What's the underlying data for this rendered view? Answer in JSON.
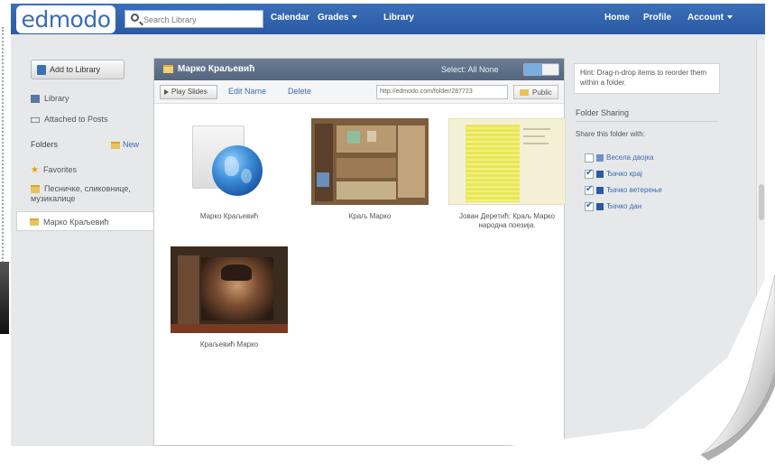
{
  "brand": {
    "logo_text": "edmodo"
  },
  "search": {
    "placeholder": "Search Library"
  },
  "nav": {
    "calendar": "Calendar",
    "grades": "Grades",
    "library": "Library",
    "home": "Home",
    "profile": "Profile",
    "account": "Account"
  },
  "sidebar": {
    "add_button": "Add to Library",
    "library": "Library",
    "attached": "Attached to Posts",
    "folders_label": "Folders",
    "new_label": "New",
    "items": [
      {
        "label": "Favorites"
      },
      {
        "label": "Песничке, сликовнице, музикалице"
      },
      {
        "label": "Марко Краљевић"
      }
    ]
  },
  "main": {
    "folder_title": "Марко Краљевић",
    "select_label": "Select: All None",
    "play_label": "Play Slides",
    "edit_label": "Edit Name",
    "delete_label": "Delete",
    "url_value": "http://edmodo.com/folder/287723",
    "public_label": "Public",
    "items": [
      {
        "caption": "Марко Краљевић"
      },
      {
        "caption": "Краљ Марко"
      },
      {
        "caption": "Јован Деретић: Краљ Марко народна поезија."
      },
      {
        "caption": "Краљевић Марко"
      }
    ]
  },
  "right": {
    "hint": "Hint: Drag-n-drop items to reorder them within a folder.",
    "sharing_title": "Folder Sharing",
    "share_with": "Share this folder with:",
    "groups": [
      {
        "label": "Весела двојка",
        "checked": false
      },
      {
        "label": "Ђачко крај",
        "checked": true
      },
      {
        "label": "Ђачко ветерење",
        "checked": true
      },
      {
        "label": "Ђачко дан",
        "checked": true
      }
    ]
  },
  "colors": {
    "topbar": "#2f60a8",
    "link": "#3a6db5",
    "panel_header": "#5f7189"
  }
}
